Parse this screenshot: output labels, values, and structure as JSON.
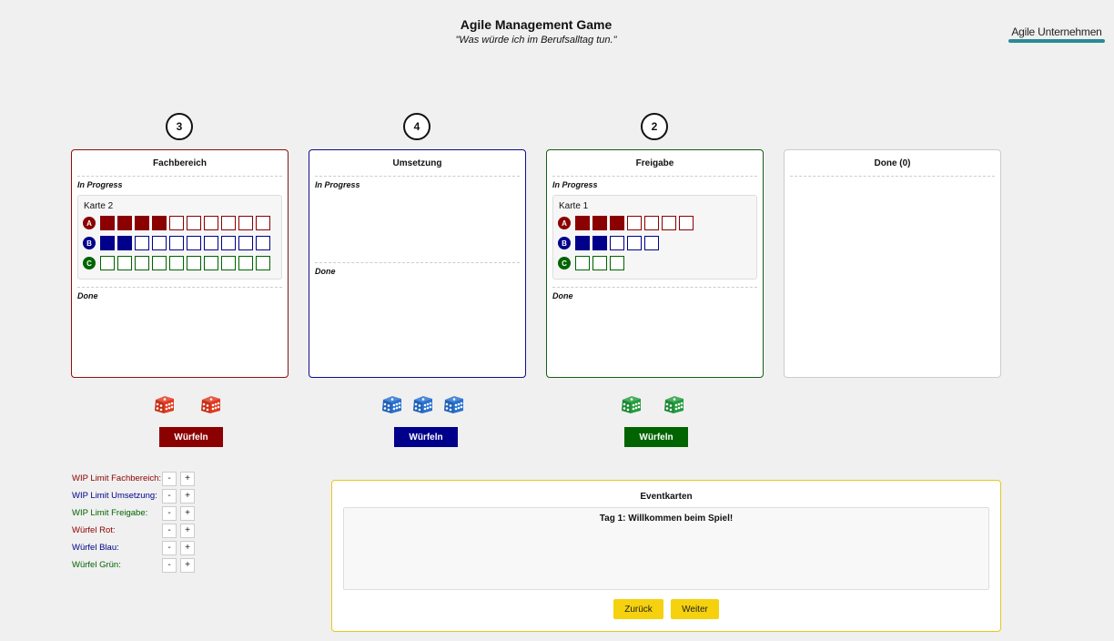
{
  "header": {
    "title": "Agile Management Game",
    "subtitle": "\"Was würde ich im Berufsalltag tun.\""
  },
  "logo": {
    "name": "Agile Unternehmen"
  },
  "colors": {
    "red": "#8b0000",
    "blue": "#00008b",
    "green": "#006400",
    "yellow": "#f5d20d"
  },
  "columns": [
    {
      "title": "Fachbereich",
      "wip": "3",
      "in_progress": "In Progress",
      "done": "Done",
      "card": {
        "title": "Karte 2",
        "rows": [
          {
            "label": "A",
            "filled": 4,
            "total": 10
          },
          {
            "label": "B",
            "filled": 2,
            "total": 10
          },
          {
            "label": "C",
            "filled": 0,
            "total": 10
          }
        ]
      },
      "dice_count": 2,
      "dice_icon": "red-die-icon",
      "roll_label": "Würfeln"
    },
    {
      "title": "Umsetzung",
      "wip": "4",
      "in_progress": "In Progress",
      "done": "Done",
      "dice_count": 3,
      "dice_icon": "blue-die-icon",
      "roll_label": "Würfeln"
    },
    {
      "title": "Freigabe",
      "wip": "2",
      "in_progress": "In Progress",
      "done": "Done",
      "card": {
        "title": "Karte 1",
        "rows": [
          {
            "label": "A",
            "filled": 3,
            "total": 7
          },
          {
            "label": "B",
            "filled": 2,
            "total": 5
          },
          {
            "label": "C",
            "filled": 0,
            "total": 3
          }
        ]
      },
      "dice_count": 2,
      "dice_icon": "green-die-icon",
      "roll_label": "Würfeln"
    },
    {
      "title": "Done (0)"
    }
  ],
  "settings": [
    {
      "label": "WIP Limit Fachbereich:",
      "color": "#8b0000"
    },
    {
      "label": "WIP Limit Umsetzung:",
      "color": "#00008b"
    },
    {
      "label": "WIP Limit Freigabe:",
      "color": "#006400"
    },
    {
      "label": "Würfel Rot:",
      "color": "#8b0000"
    },
    {
      "label": "Würfel Blau:",
      "color": "#00008b"
    },
    {
      "label": "Würfel Grün:",
      "color": "#006400"
    }
  ],
  "stepper": {
    "minus": "-",
    "plus": "+"
  },
  "events": {
    "title": "Eventkarten",
    "message": "Tag 1: Willkommen beim Spiel!",
    "back_label": "Zurück",
    "next_label": "Weiter"
  }
}
